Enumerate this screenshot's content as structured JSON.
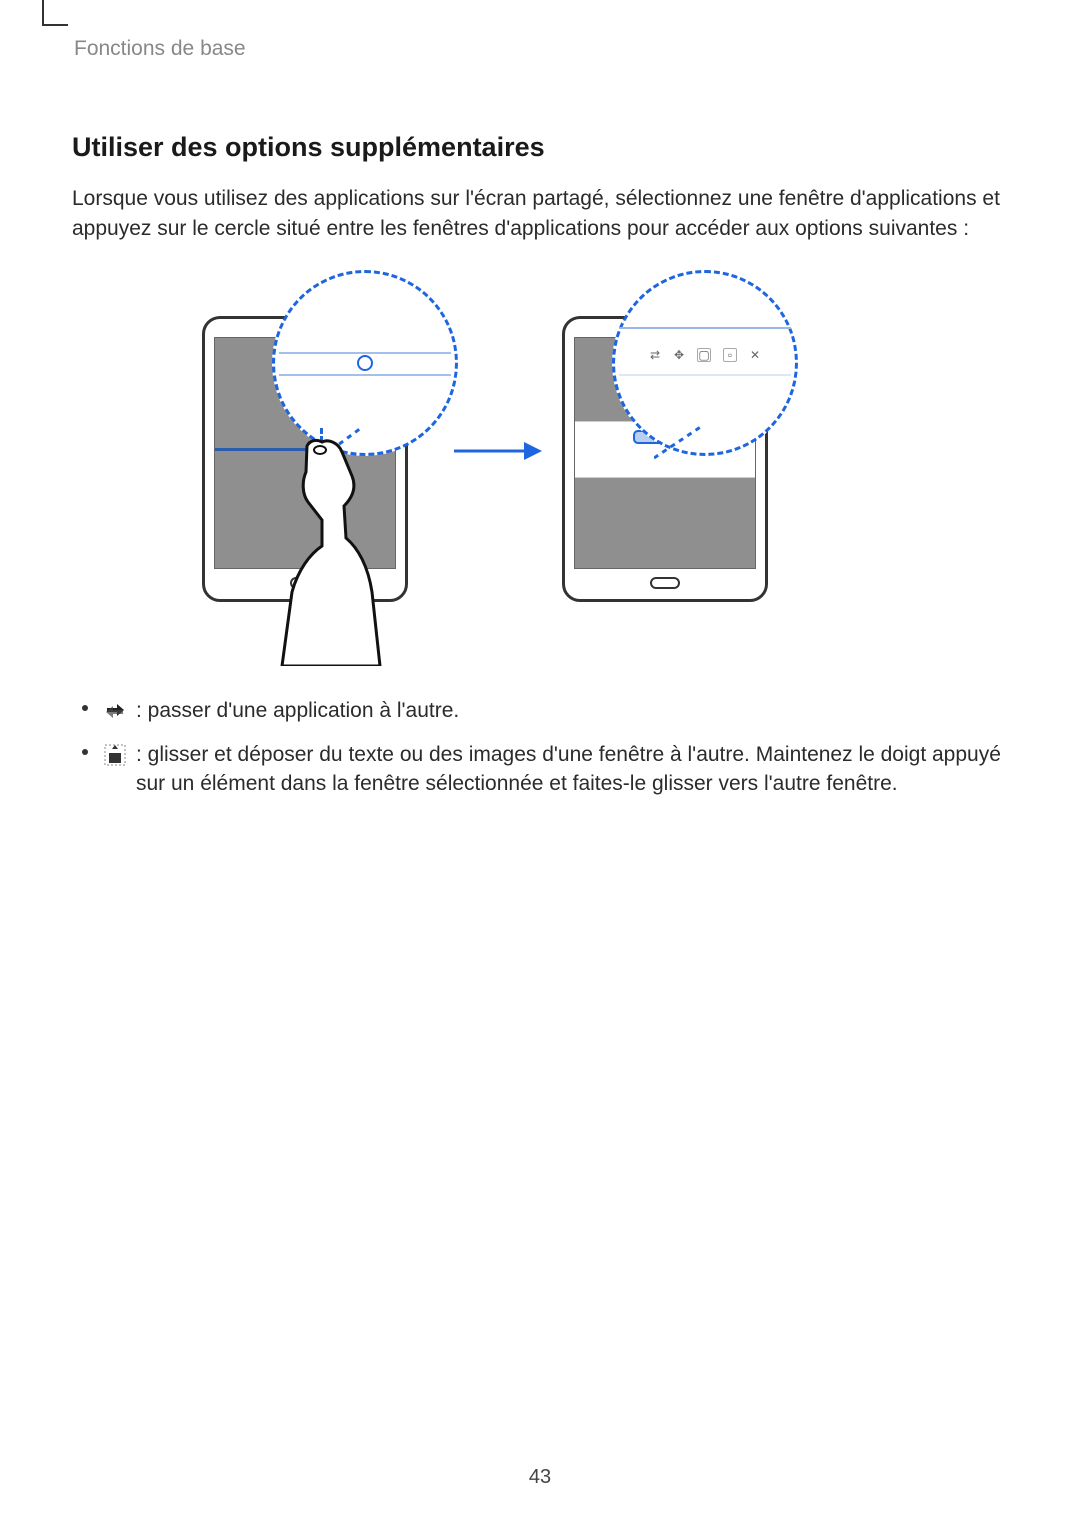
{
  "header": {
    "breadcrumb": "Fonctions de base"
  },
  "section": {
    "title": "Utiliser des options supplémentaires",
    "intro": "Lorsque vous utilisez des applications sur l'écran partagé, sélectionnez une fenêtre d'applications et appuyez sur le cercle situé entre les fenêtres d'applications pour accéder aux options suivantes :"
  },
  "bullets": [
    {
      "icon_name": "swap-apps-icon",
      "text": " : passer d'une application à l'autre."
    },
    {
      "icon_name": "drag-content-icon",
      "text": " : glisser et déposer du texte ou des images d'une fenêtre à l'autre. Maintenez le doigt appuyé sur un élément dans la fenêtre sélectionnée et faites-le glisser vers l'autre fenêtre."
    }
  ],
  "figure": {
    "arrow_label": "transition",
    "callout_toolbar_icons": [
      "swap",
      "drag",
      "maximize",
      "minimize",
      "close"
    ]
  },
  "page_number": "43"
}
